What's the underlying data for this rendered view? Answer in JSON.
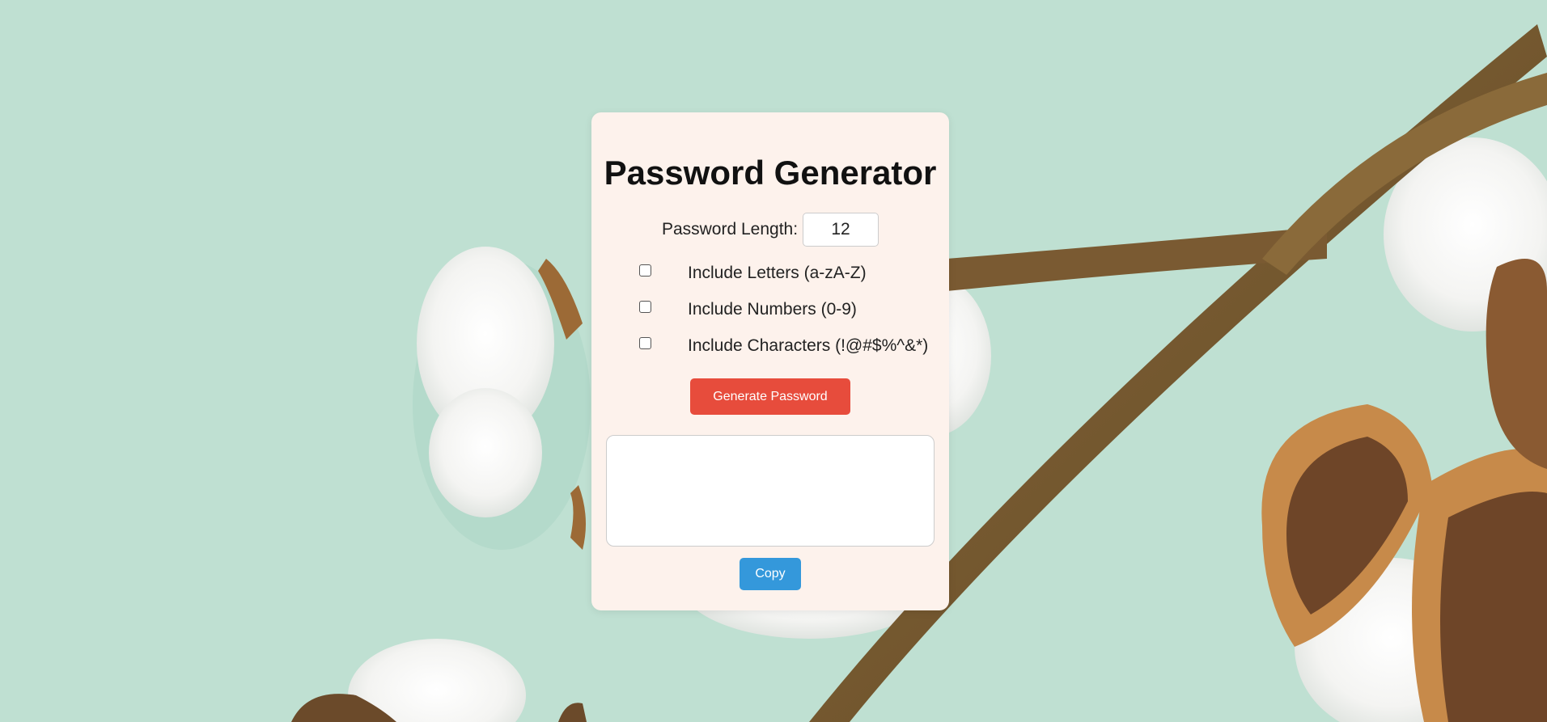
{
  "app": {
    "title": "Password Generator"
  },
  "length": {
    "label": "Password Length:",
    "value": "12"
  },
  "options": [
    {
      "label": "Include Letters (a-zA-Z)",
      "checked": false
    },
    {
      "label": "Include Numbers (0-9)",
      "checked": false
    },
    {
      "label": "Include Characters (!@#$%^&*)",
      "checked": false
    }
  ],
  "buttons": {
    "generate_label": "Generate Password",
    "copy_label": "Copy"
  },
  "output": {
    "value": ""
  },
  "colors": {
    "background": "#bfe0d2",
    "card": "#fdf2ec",
    "generate": "#e74c3c",
    "copy": "#3498db"
  }
}
